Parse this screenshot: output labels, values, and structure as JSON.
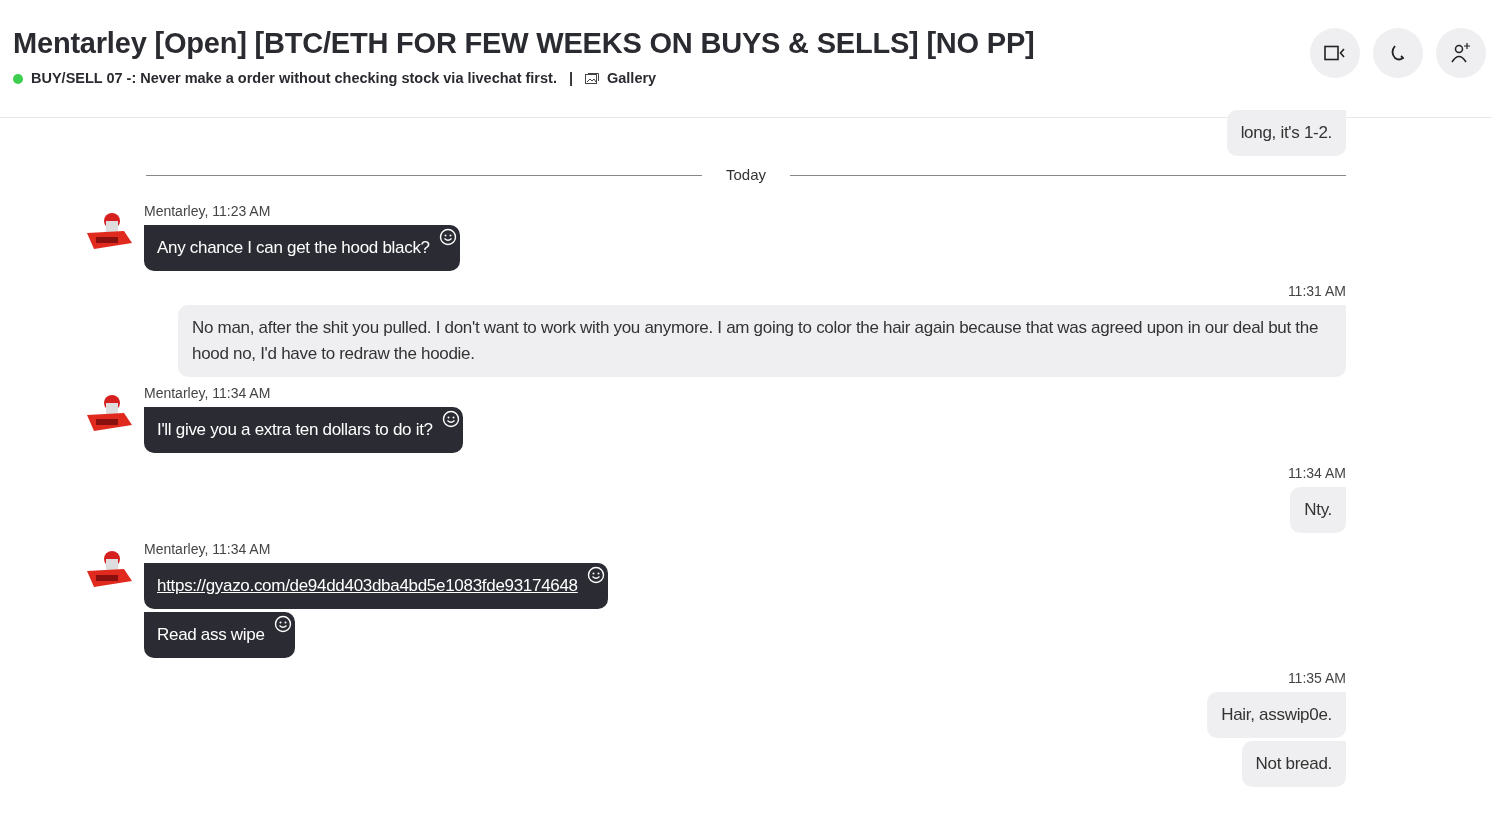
{
  "header": {
    "title": "Mentarley [Open] [BTC/ETH FOR FEW WEEKS ON BUYS & SELLS] [NO PP]",
    "online": true,
    "status": "BUY/SELL 07 -: Never make a order without checking stock via livechat first.",
    "separator": "|",
    "gallery": "Gallery"
  },
  "messages": [
    {
      "kind": "outgoing",
      "bubbles": [
        "long, it's 1-2."
      ]
    },
    {
      "kind": "divider",
      "label": "Today"
    },
    {
      "kind": "incoming",
      "meta": "Mentarley, 11:23 AM",
      "bubbles": [
        {
          "text": "Any chance I can get the hood black?",
          "link": false
        }
      ]
    },
    {
      "kind": "outgoing",
      "time": "11:31 AM",
      "bubbles": [
        "No man, after the shit you pulled. I don't want to work with you anymore. I am going to color the hair again because that was agreed upon in our deal but the hood no, I'd have to redraw the hoodie."
      ]
    },
    {
      "kind": "incoming",
      "meta": "Mentarley, 11:34 AM",
      "bubbles": [
        {
          "text": "I'll give you a extra ten dollars to do it?",
          "link": false
        }
      ]
    },
    {
      "kind": "outgoing",
      "time": "11:34 AM",
      "bubbles": [
        "Nty."
      ]
    },
    {
      "kind": "incoming",
      "meta": "Mentarley, 11:34 AM",
      "bubbles": [
        {
          "text": "https://gyazo.com/de94dd403dba4bd5e1083fde93174648",
          "link": true
        },
        {
          "text": "Read ass wipe",
          "link": false
        }
      ]
    },
    {
      "kind": "outgoing",
      "time": "11:35 AM",
      "bubbles": [
        "Hair, asswip0e.",
        "Not bread."
      ]
    }
  ]
}
